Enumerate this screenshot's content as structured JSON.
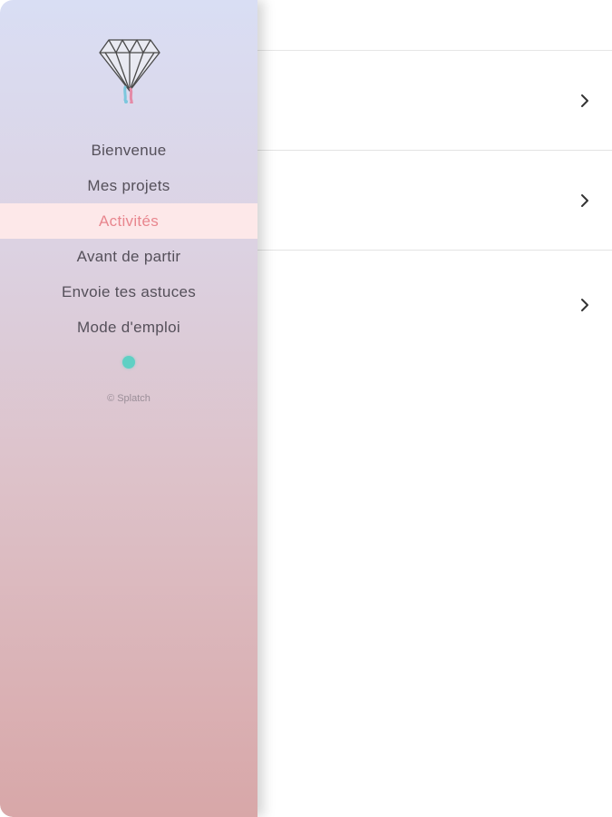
{
  "menu": {
    "items": [
      {
        "label": "Bienvenue"
      },
      {
        "label": "Mes projets"
      },
      {
        "label": "Activités"
      },
      {
        "label": "Avant de partir"
      },
      {
        "label": "Envoie tes astuces"
      },
      {
        "label": "Mode d'emploi"
      }
    ],
    "active_index": 2
  },
  "footer": {
    "copyright": "© Splatch"
  },
  "icons": {
    "logo": "diamond-logo",
    "chevron": "chevron-right-icon",
    "status": "status-dot"
  },
  "colors": {
    "active_text": "#e8868e",
    "active_bg": "#fde8e9",
    "status_dot": "#5fd0c4"
  }
}
